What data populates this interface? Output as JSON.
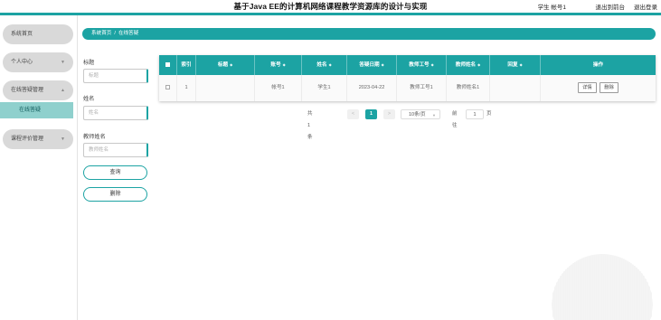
{
  "header": {
    "title": "基于Java EE的计算机网络课程教学资源库的设计与实现",
    "user_label": "学生 帐号1",
    "front_link": "退出到前台",
    "logout_link": "退出登录",
    "accent": "#1ca3a3"
  },
  "sidebar": {
    "items": [
      {
        "label": "系统首页"
      },
      {
        "label": "个人中心",
        "chevron": "chevron-down-icon"
      },
      {
        "label": "在线答疑管理",
        "chevron": "chevron-down-icon"
      },
      {
        "label": "在线答疑"
      },
      {
        "label": "课程评价管理",
        "chevron": "chevron-down-icon"
      }
    ],
    "active_color": "#8fd0cd"
  },
  "breadcrumb": {
    "home": "系统首页",
    "separator": "/",
    "current": "在线答疑"
  },
  "search": {
    "title_label": "标题",
    "title_placeholder": "标题",
    "name_label": "姓名",
    "name_placeholder": "姓名",
    "teacher_label": "教师姓名",
    "teacher_placeholder": "教师姓名",
    "query_button": "查询",
    "delete_button": "删除"
  },
  "table": {
    "columns": [
      "索引",
      "标题",
      "账号",
      "姓名",
      "答疑日期",
      "教师工号",
      "教师姓名",
      "回复",
      "操作"
    ],
    "rows": [
      {
        "index": "1",
        "title": "",
        "account": "帐号1",
        "name": "学生1",
        "date": "2023-04-22",
        "teacher_id": "教师工号1",
        "teacher_name": "教师姓名1",
        "reply": "",
        "actions": [
          "详情",
          "删除"
        ]
      }
    ]
  },
  "pagination": {
    "total": "共 1 条",
    "prev": "<",
    "current_page": "1",
    "next": ">",
    "page_size": "10条/页",
    "goto_label": "前往",
    "goto_value": "1",
    "page_unit": "页"
  }
}
